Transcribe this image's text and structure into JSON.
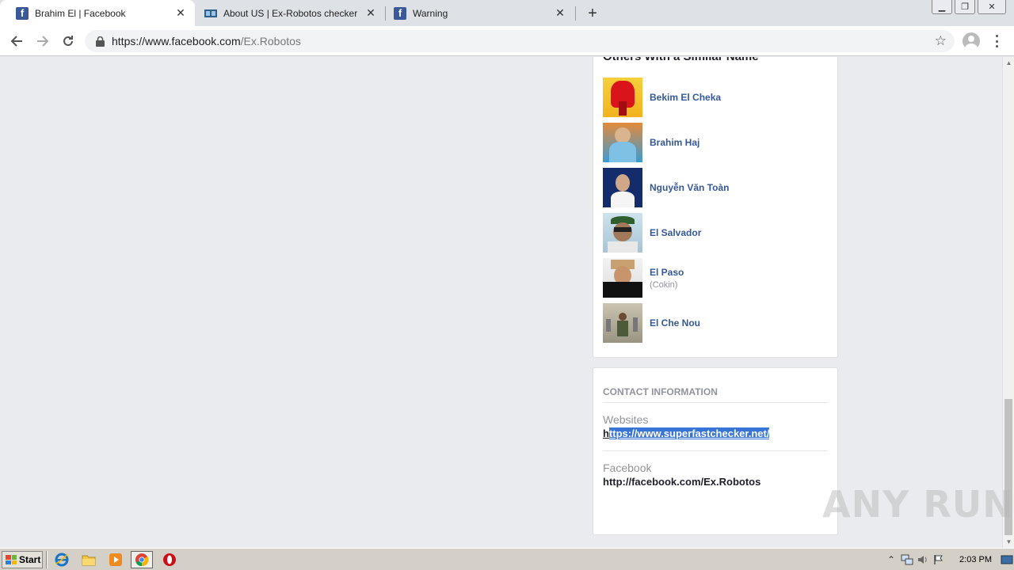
{
  "browser": {
    "tabs": [
      {
        "title": "Brahim El | Facebook",
        "favicon": "facebook-icon",
        "active": true
      },
      {
        "title": "About US | Ex-Robotos checker",
        "favicon": "site-icon",
        "active": false
      },
      {
        "title": "Warning",
        "favicon": "facebook-icon",
        "active": false
      }
    ],
    "new_tab_label": "+",
    "address": {
      "host": "https://www.facebook.com",
      "path": "/Ex.Robotos"
    }
  },
  "similar": {
    "title": "Others With a Similar Name",
    "people": [
      {
        "name": "Bekim El Cheka",
        "sub": ""
      },
      {
        "name": "Brahim Haj",
        "sub": ""
      },
      {
        "name": "Nguyễn Văn Toàn",
        "sub": ""
      },
      {
        "name": "El Salvador",
        "sub": ""
      },
      {
        "name": "El Paso",
        "sub": "(Cokin)"
      },
      {
        "name": "El Che Nou",
        "sub": ""
      }
    ]
  },
  "contact": {
    "header": "CONTACT INFORMATION",
    "websites_label": "Websites",
    "website_first_char": "h",
    "website_rest": "ttps://www.superfastchecker.net/",
    "facebook_label": "Facebook",
    "facebook_value": "http://facebook.com/Ex.Robotos"
  },
  "watermark": "ANY RUN",
  "taskbar": {
    "start_label": "Start",
    "clock": "2:03 PM"
  }
}
